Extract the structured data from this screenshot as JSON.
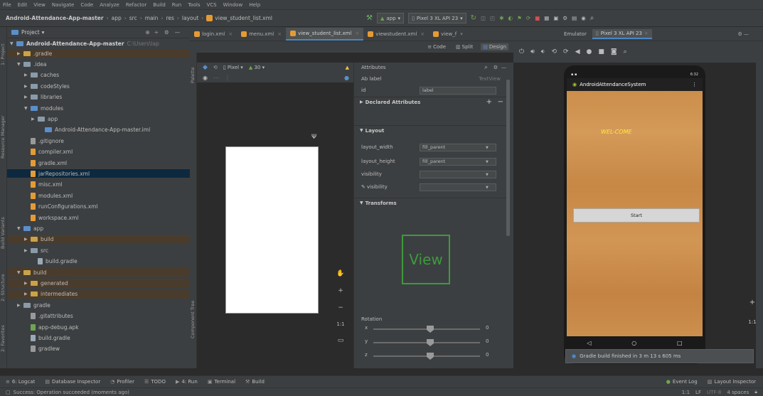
{
  "menu": [
    "File",
    "Edit",
    "View",
    "Navigate",
    "Code",
    "Analyze",
    "Refactor",
    "Build",
    "Run",
    "Tools",
    "VCS",
    "Window",
    "Help"
  ],
  "breadcrumb": {
    "project": "Android-Attendance-App-master",
    "parts": [
      "app",
      "src",
      "main",
      "res",
      "layout"
    ],
    "file": "view_student_list.xml"
  },
  "run": {
    "config": "app",
    "device": "Pixel 3 XL API 23"
  },
  "project_panel": {
    "title": "Project",
    "root": "Android-Attendance-App-master",
    "root_path": "C:\\Users\\lap",
    "items": [
      {
        "label": ".gradle",
        "indent": 1,
        "type": "folder-orange",
        "arrow": "▶",
        "style": "excl"
      },
      {
        "label": ".idea",
        "indent": 1,
        "type": "folder",
        "arrow": "▼",
        "style": ""
      },
      {
        "label": "caches",
        "indent": 2,
        "type": "folder",
        "arrow": "▶",
        "style": ""
      },
      {
        "label": "codeStyles",
        "indent": 2,
        "type": "folder",
        "arrow": "▶",
        "style": ""
      },
      {
        "label": "libraries",
        "indent": 2,
        "type": "folder",
        "arrow": "▶",
        "style": ""
      },
      {
        "label": "modules",
        "indent": 2,
        "type": "folder-blue",
        "arrow": "▼",
        "style": ""
      },
      {
        "label": "app",
        "indent": 3,
        "type": "folder",
        "arrow": "▶",
        "style": ""
      },
      {
        "label": "Android-Attendance-App-master.iml",
        "indent": 4,
        "type": "iml",
        "arrow": "",
        "style": ""
      },
      {
        "label": ".gitignore",
        "indent": 2,
        "type": "gray",
        "arrow": "",
        "style": ""
      },
      {
        "label": "compiler.xml",
        "indent": 2,
        "type": "xml",
        "arrow": "",
        "style": ""
      },
      {
        "label": "gradle.xml",
        "indent": 2,
        "type": "xml",
        "arrow": "",
        "style": ""
      },
      {
        "label": "jarRepositories.xml",
        "indent": 2,
        "type": "xml",
        "arrow": "",
        "style": "sel"
      },
      {
        "label": "misc.xml",
        "indent": 2,
        "type": "xml",
        "arrow": "",
        "style": ""
      },
      {
        "label": "modules.xml",
        "indent": 2,
        "type": "xml",
        "arrow": "",
        "style": ""
      },
      {
        "label": "runConfigurations.xml",
        "indent": 2,
        "type": "xml",
        "arrow": "",
        "style": ""
      },
      {
        "label": "workspace.xml",
        "indent": 2,
        "type": "xml",
        "arrow": "",
        "style": ""
      },
      {
        "label": "app",
        "indent": 1,
        "type": "folder-blue",
        "arrow": "▼",
        "style": ""
      },
      {
        "label": "build",
        "indent": 2,
        "type": "folder-orange",
        "arrow": "▶",
        "style": "excl"
      },
      {
        "label": "src",
        "indent": 2,
        "type": "folder",
        "arrow": "▶",
        "style": ""
      },
      {
        "label": "build.gradle",
        "indent": 3,
        "type": "gradle",
        "arrow": "",
        "style": ""
      },
      {
        "label": "build",
        "indent": 1,
        "type": "folder-orange",
        "arrow": "▼",
        "style": "excl"
      },
      {
        "label": "generated",
        "indent": 2,
        "type": "folder-orange",
        "arrow": "▶",
        "style": "excl"
      },
      {
        "label": "intermediates",
        "indent": 2,
        "type": "folder-orange",
        "arrow": "▶",
        "style": "excl"
      },
      {
        "label": "gradle",
        "indent": 1,
        "type": "folder",
        "arrow": "▶",
        "style": ""
      },
      {
        "label": ".gitattributes",
        "indent": 2,
        "type": "gray",
        "arrow": "",
        "style": ""
      },
      {
        "label": "app-debug.apk",
        "indent": 2,
        "type": "apk",
        "arrow": "",
        "style": ""
      },
      {
        "label": "build.gradle",
        "indent": 2,
        "type": "gradle",
        "arrow": "",
        "style": ""
      },
      {
        "label": "gradlew",
        "indent": 2,
        "type": "gray",
        "arrow": "",
        "style": ""
      }
    ]
  },
  "editor_tabs": [
    {
      "label": "login.xml",
      "active": false
    },
    {
      "label": "menu.xml",
      "active": false
    },
    {
      "label": "view_student_list.xml",
      "active": true
    },
    {
      "label": "viewstudent.xml",
      "active": false
    },
    {
      "label": "view_f",
      "active": false
    }
  ],
  "emulator_tabs": {
    "label": "Emulator",
    "device": "Pixel 3 XL API 23"
  },
  "design_modes": [
    "Code",
    "Split",
    "Design"
  ],
  "canvas": {
    "device": "Pixel",
    "api": "30"
  },
  "attributes": {
    "title": "Attributes",
    "component": "Ab label",
    "component_type": "TextView",
    "id_label": "id",
    "id_value": "label",
    "declared": "Declared Attributes",
    "layout_section": "Layout",
    "layout_rows": [
      {
        "name": "layout_width",
        "value": "fill_parent"
      },
      {
        "name": "layout_height",
        "value": "fill_parent"
      },
      {
        "name": "visibility",
        "value": ""
      },
      {
        "name": "visibility",
        "value": ""
      }
    ],
    "transforms": "Transforms",
    "view_label": "View",
    "rotation": "Rotation",
    "slider_axes": [
      "x",
      "y",
      "z"
    ],
    "slider_value": "0"
  },
  "device": {
    "app_title": "AndroidAttendanceSystem",
    "welcome": "WEL-COME",
    "start_button": "Start",
    "status_right": "6:32"
  },
  "notification": "Gradle build finished in 3 m 13 s 605 ms",
  "bottom_tools": [
    "6: Logcat",
    "Database Inspector",
    "Profiler",
    "TODO",
    "4: Run",
    "Terminal",
    "Build"
  ],
  "bottom_right": [
    "Event Log",
    "Layout Inspector"
  ],
  "status": {
    "message": "Success: Operation succeeded (moments ago)",
    "position": "1:1",
    "line_sep": "LF",
    "encoding": "UTF-8",
    "indent": "4 spaces"
  },
  "left_strip_tabs": [
    "1: Project",
    "Resource Manager",
    "Build Variants",
    "2: Structure",
    "2: Favorites"
  ],
  "palette_tabs": [
    "Palette",
    "Component Tree"
  ],
  "zoom": {
    "ratio": "1:1"
  }
}
